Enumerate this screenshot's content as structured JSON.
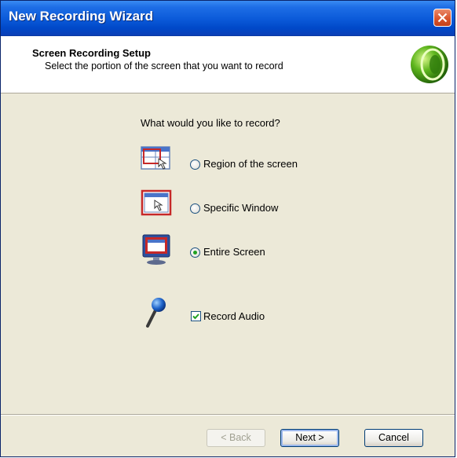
{
  "window": {
    "title": "New Recording Wizard"
  },
  "header": {
    "title": "Screen Recording Setup",
    "subtitle": "Select the portion of the screen that you want to record"
  },
  "main": {
    "prompt": "What would you like to record?",
    "options": [
      {
        "label": "Region of the screen",
        "selected": false,
        "icon": "region-select-icon"
      },
      {
        "label": "Specific Window",
        "selected": false,
        "icon": "window-select-icon"
      },
      {
        "label": "Entire Screen",
        "selected": true,
        "icon": "monitor-icon"
      }
    ],
    "audio": {
      "label": "Record Audio",
      "checked": true,
      "icon": "microphone-icon"
    }
  },
  "buttons": {
    "back": "< Back",
    "next": "Next >",
    "cancel": "Cancel"
  },
  "colors": {
    "titlebar": "#0a59d8",
    "dialog_bg": "#ece9d8",
    "accent_red": "#c62828"
  }
}
